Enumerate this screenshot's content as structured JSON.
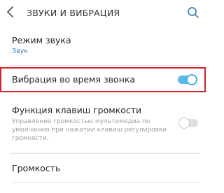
{
  "header": {
    "title": "ЗВУКИ И ВИБРАЦИЯ"
  },
  "settings": {
    "sound_mode": {
      "label": "Режим звука",
      "value": "Звук"
    },
    "vibrate_on_call": {
      "label": "Вибрация во время звонка",
      "enabled": true
    },
    "volume_keys_media": {
      "label": "Функция клавиш громкости",
      "description": "Управление громкостью мультимедиа по умолчанию при нажатии клавиш регулировки громкости.",
      "enabled": false
    },
    "volume": {
      "label": "Громкость"
    }
  },
  "colors": {
    "accent": "#5ab9e6",
    "subtitle": "#3e7fbe",
    "highlight_border": "#d5232b"
  },
  "icons": {
    "back": "chevron-left-icon",
    "search": "search-icon"
  }
}
